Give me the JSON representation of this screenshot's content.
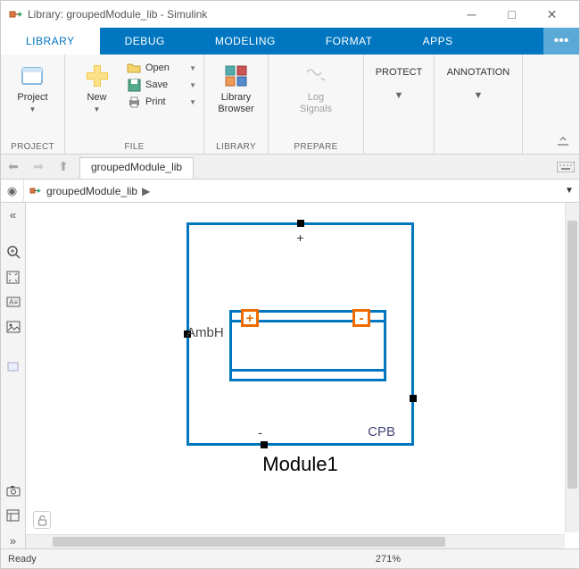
{
  "title": "Library: groupedModule_lib - Simulink",
  "tabs": [
    "LIBRARY",
    "DEBUG",
    "MODELING",
    "FORMAT",
    "APPS"
  ],
  "ribbon": {
    "project": {
      "label": "PROJECT",
      "button": "Project"
    },
    "file": {
      "label": "FILE",
      "newBtn": "New",
      "open": "Open",
      "save": "Save",
      "print": "Print"
    },
    "library": {
      "label": "LIBRARY",
      "button": "Library\nBrowser"
    },
    "prepare": {
      "label": "PREPARE",
      "button": "Log\nSignals"
    },
    "protect": "PROTECT",
    "annotation": "ANNOTATION"
  },
  "navtab": "groupedModule_lib",
  "breadcrumb": "groupedModule_lib",
  "block": {
    "name": "Module1",
    "portPlus": "+",
    "portMinus": "-",
    "portAmb": "AmbH",
    "portCPB": "CPB",
    "termPlus": "+",
    "termMinus": "-"
  },
  "status": {
    "ready": "Ready",
    "zoom": "271%"
  }
}
